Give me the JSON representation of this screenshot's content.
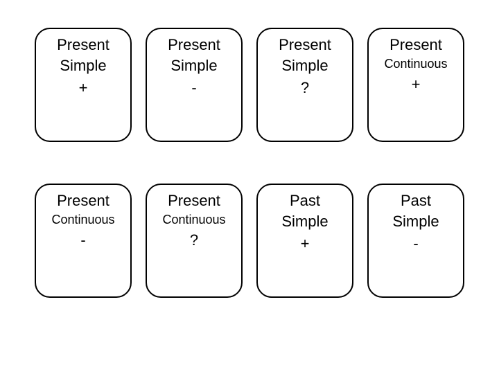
{
  "cards": [
    {
      "line1": "Present",
      "line2": "Simple",
      "symbol": "+",
      "smallLine2": false
    },
    {
      "line1": "Present",
      "line2": "Simple",
      "symbol": "-",
      "smallLine2": false
    },
    {
      "line1": "Present",
      "line2": "Simple",
      "symbol": "?",
      "smallLine2": false
    },
    {
      "line1": "Present",
      "line2": "Continuous",
      "symbol": "+",
      "smallLine2": true
    },
    {
      "line1": "Present",
      "line2": "Continuous",
      "symbol": "-",
      "smallLine2": true
    },
    {
      "line1": "Present",
      "line2": "Continuous",
      "symbol": "?",
      "smallLine2": true
    },
    {
      "line1": "Past",
      "line2": "Simple",
      "symbol": "+",
      "smallLine2": false
    },
    {
      "line1": "Past",
      "line2": "Simple",
      "symbol": "-",
      "smallLine2": false
    }
  ]
}
